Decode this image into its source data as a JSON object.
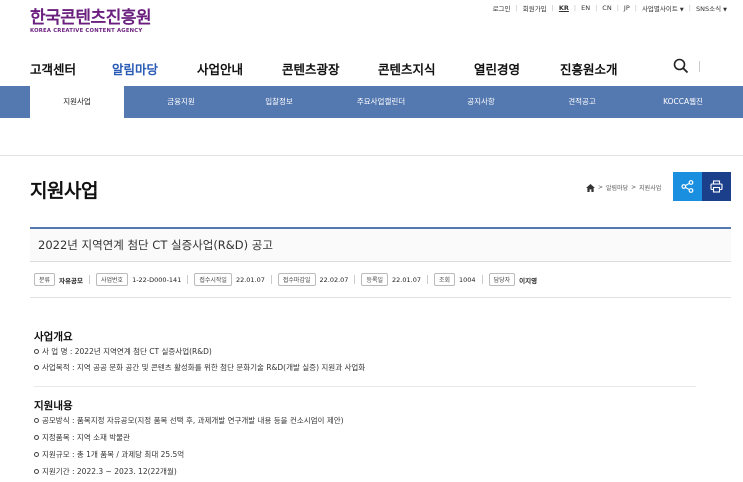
{
  "util": {
    "login": "로그인",
    "join": "회원가입",
    "lang_kr": "KR",
    "lang_en": "EN",
    "lang_cn": "CN",
    "lang_jp": "JP",
    "sites": "사업별사이트",
    "sns": "SNS소식"
  },
  "logo": {
    "ko": "한국콘텐츠진흥원",
    "en": "KOREA CREATIVE CONTENT AGENCY"
  },
  "mainnav": [
    "고객센터",
    "알림마당",
    "사업안내",
    "콘텐츠광장",
    "콘텐츠지식",
    "열린경영",
    "진흥원소개"
  ],
  "subnav": [
    "지원사업",
    "금융지원",
    "입찰정보",
    "주요사업캘린더",
    "공지사항",
    "견적공고",
    "KOCCA웹진"
  ],
  "page": {
    "title": "지원사업",
    "crumb_1": "알림마당",
    "crumb_2": "지원사업"
  },
  "notice": {
    "title": "2022년 지역연계 첨단 CT 실증사업(R&D) 공고",
    "meta": {
      "category_label": "분류",
      "category": "자유공모",
      "bizno_label": "사업번호",
      "bizno": "1-22-D000-141",
      "start_label": "접수시작일",
      "start": "22.01.07",
      "end_label": "접수마감일",
      "end": "22.02.07",
      "reg_label": "등록일",
      "reg": "22.01.07",
      "views_label": "조회",
      "views": "1004",
      "manager_label": "담당자",
      "manager": "이지영"
    }
  },
  "content": {
    "overview_heading": "사업개요",
    "overview": [
      "사 업 명 : 2022년 지역연계 첨단 CT 실증사업(R&D)",
      "사업목적 : 지역 공공 문화 공간 및 콘텐츠 활성화를 위한 첨단 문화기술 R&D(개발 실증) 지원과 사업화"
    ],
    "support_heading": "지원내용",
    "support": [
      "공모방식 : 품목지정 자유공모(지정 품목 선택 후, 과제개발 연구개발 내용 등을 컨소시엄이 제안)",
      "지정품목 : 지역 소재 박물관",
      "지원규모 : 총 1개 품목 / 과제당 최대 25.5억",
      "지원기간 : 2022.3 ~ 2023. 12(22개월)"
    ]
  }
}
